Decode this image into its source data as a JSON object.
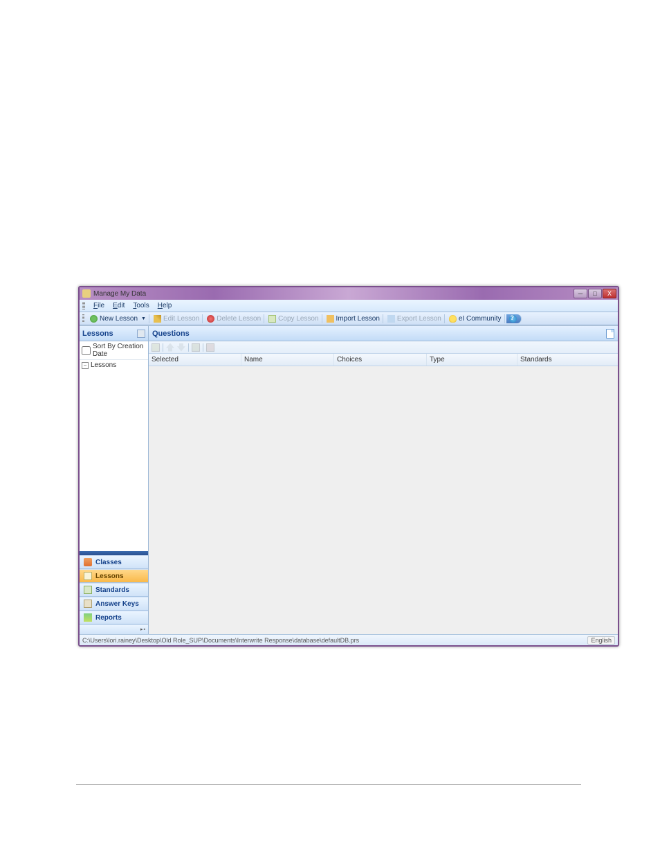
{
  "window": {
    "title": "Manage My Data"
  },
  "menu": {
    "file": "File",
    "edit": "Edit",
    "tools": "Tools",
    "help": "Help"
  },
  "toolbar": {
    "new_lesson": "New Lesson",
    "edit_lesson": "Edit Lesson",
    "delete_lesson": "Delete Lesson",
    "copy_lesson": "Copy Lesson",
    "import_lesson": "Import Lesson",
    "export_lesson": "Export Lesson",
    "ei_community": "eI Community"
  },
  "left": {
    "header": "Lessons",
    "sort_label": "Sort By Creation Date",
    "tree_root": "Lessons"
  },
  "nav": {
    "classes": "Classes",
    "lessons": "Lessons",
    "standards": "Standards",
    "answer_keys": "Answer Keys",
    "reports": "Reports"
  },
  "right": {
    "header": "Questions",
    "columns": {
      "selected": "Selected",
      "name": "Name",
      "choices": "Choices",
      "type": "Type",
      "standards": "Standards"
    }
  },
  "status": {
    "path": "C:\\Users\\lori.rainey\\Desktop\\Old Role_SUP\\Documents\\Interwrite Response\\database\\defaultDB.prs",
    "language": "English"
  }
}
